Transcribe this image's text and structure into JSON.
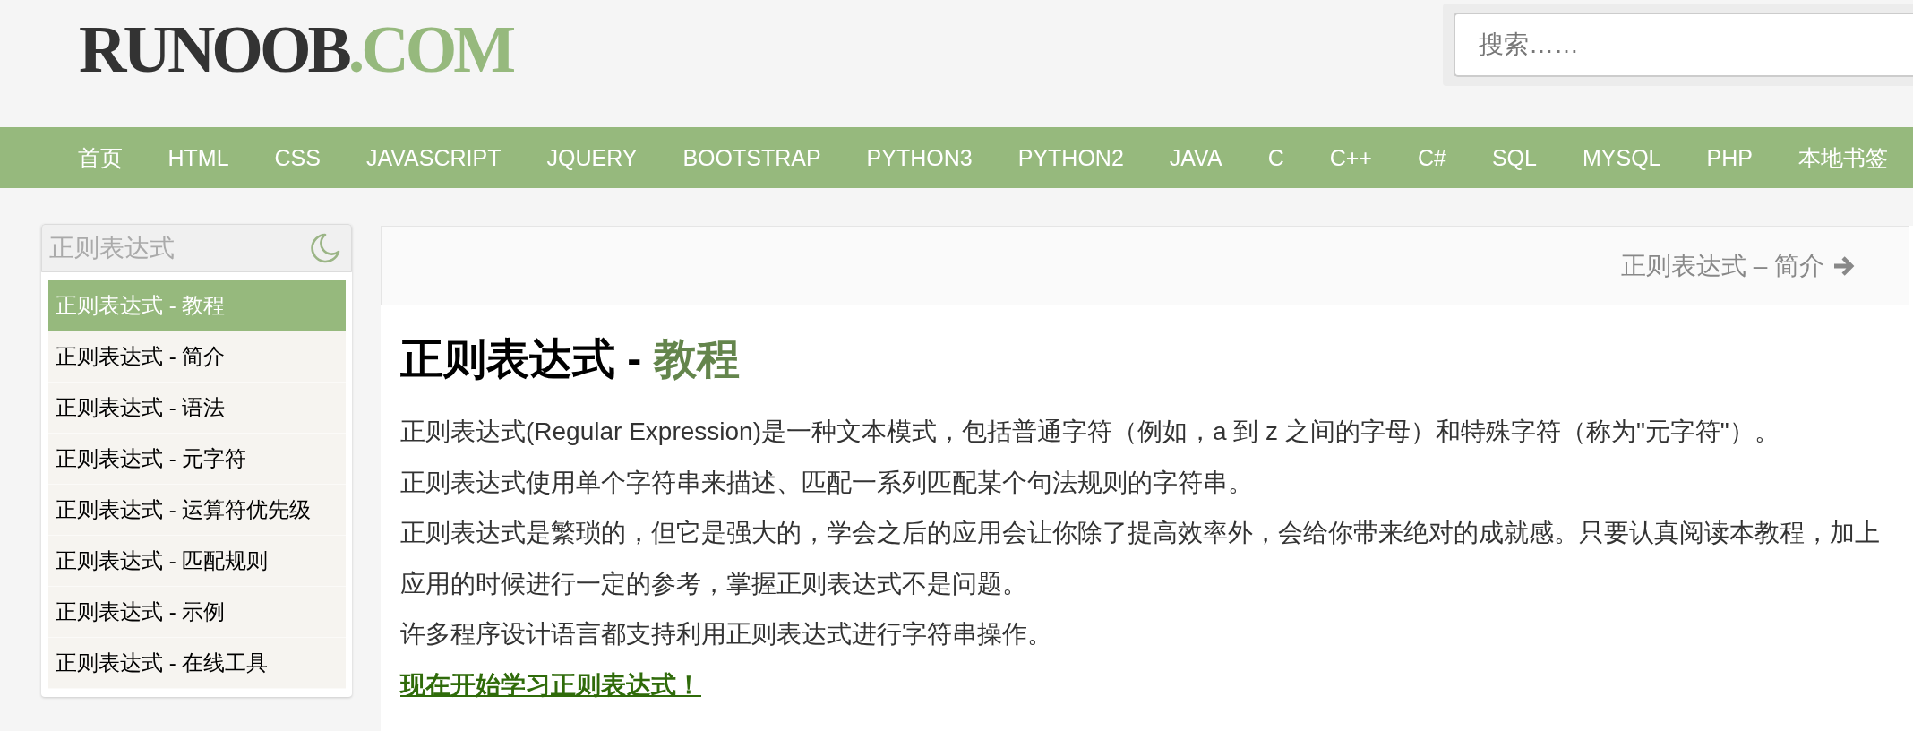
{
  "logo": {
    "name": "RUNOOB",
    "domain": ".COM"
  },
  "search": {
    "placeholder": "搜索……"
  },
  "nav": [
    {
      "label": "首页"
    },
    {
      "label": "HTML"
    },
    {
      "label": "CSS"
    },
    {
      "label": "JAVASCRIPT"
    },
    {
      "label": "JQUERY"
    },
    {
      "label": "BOOTSTRAP"
    },
    {
      "label": "PYTHON3"
    },
    {
      "label": "PYTHON2"
    },
    {
      "label": "JAVA"
    },
    {
      "label": "C"
    },
    {
      "label": "C++"
    },
    {
      "label": "C#"
    },
    {
      "label": "SQL"
    },
    {
      "label": "MYSQL"
    },
    {
      "label": "PHP"
    },
    {
      "label": "本地书签"
    }
  ],
  "sidebar": {
    "title": "正则表达式",
    "items": [
      {
        "label": "正则表达式 - 教程",
        "selected": true
      },
      {
        "label": "正则表达式 - 简介",
        "selected": false
      },
      {
        "label": "正则表达式 - 语法",
        "selected": false
      },
      {
        "label": "正则表达式 - 元字符",
        "selected": false
      },
      {
        "label": "正则表达式 - 运算符优先级",
        "selected": false
      },
      {
        "label": "正则表达式 - 匹配规则",
        "selected": false
      },
      {
        "label": "正则表达式 - 示例",
        "selected": false
      },
      {
        "label": "正则表达式 - 在线工具",
        "selected": false
      }
    ]
  },
  "pager": {
    "next": "正则表达式 – 简介"
  },
  "article": {
    "heading": {
      "title": "正则表达式 - ",
      "highlight": "教程"
    },
    "paragraphs": [
      "正则表达式(Regular Expression)是一种文本模式，包括普通字符（例如，a 到 z 之间的字母）和特殊字符（称为\"元字符\"）。",
      "正则表达式使用单个字符串来描述、匹配一系列匹配某个句法规则的字符串。",
      "正则表达式是繁琐的，但它是强大的，学会之后的应用会让你除了提高效率外，会给你带来绝对的成就感。只要认真阅读本教程，加上应用的时候进行一定的参考，掌握正则表达式不是问题。",
      "许多程序设计语言都支持利用正则表达式进行字符串操作。"
    ],
    "link": "现在开始学习正则表达式！"
  }
}
